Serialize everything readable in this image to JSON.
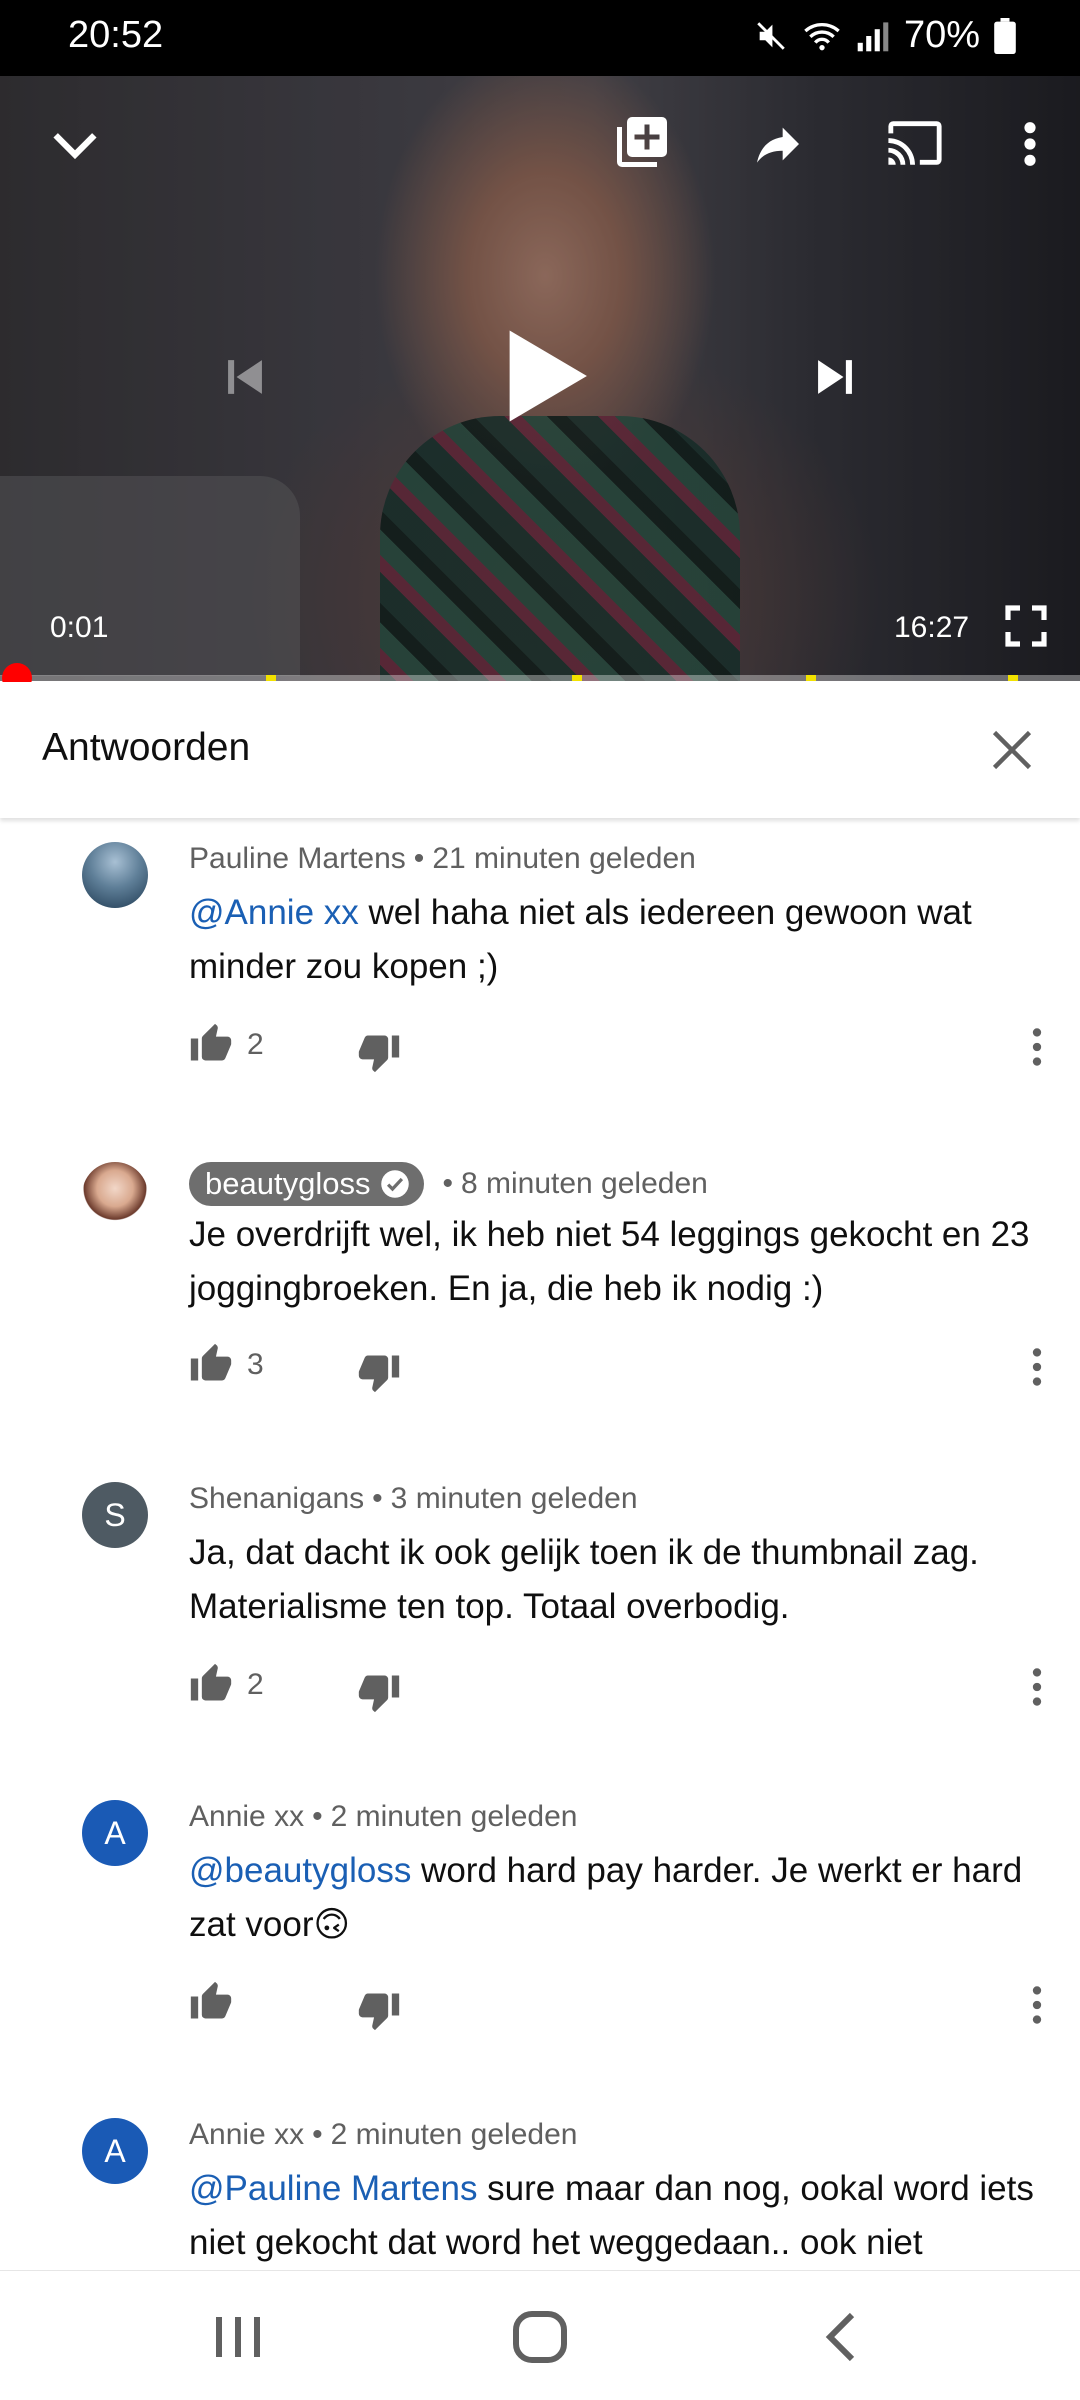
{
  "status_bar": {
    "time": "20:52",
    "battery": "70%"
  },
  "player": {
    "current_time": "0:01",
    "duration": "16:27",
    "progress_fraction": 0.0006
  },
  "replies": {
    "title": "Antwoorden"
  },
  "comments": [
    {
      "author": "Pauline Martens",
      "time": "21 minuten geleden",
      "mention": "@Annie xx",
      "text": " wel haha niet als iedereen gewoon wat minder zou kopen ;)",
      "likes": "2"
    },
    {
      "author": "beautygloss",
      "verified": true,
      "time": "8 minuten geleden",
      "mention": "",
      "text": "Je overdrijft wel, ik heb niet 54 leggings gekocht en 23 joggingbroeken. En ja, die heb ik nodig :)",
      "likes": "3"
    },
    {
      "author": "Shenanigans",
      "avatar_letter": "S",
      "time": "3 minuten geleden",
      "mention": "",
      "text": "Ja, dat dacht ik ook gelijk toen ik de thumbnail zag. Materialisme ten top. Totaal overbodig.",
      "likes": "2"
    },
    {
      "author": "Annie xx",
      "avatar_letter": "A",
      "time": "2 minuten geleden",
      "mention": "@beautygloss",
      "text": " word hard pay harder. Je werkt er hard zat voor🙃",
      "likes": ""
    },
    {
      "author": "Annie xx",
      "avatar_letter": "A",
      "time": "2 minuten geleden",
      "mention": "@Pauline Martens",
      "text": " sure maar dan nog, ookal word iets niet gekocht dat word het weggedaan.. ook niet",
      "likes": ""
    }
  ],
  "colors": {
    "accent_red": "#ff0000",
    "mention_blue": "#1a5fb4",
    "chapter_marker": "#f2e200"
  }
}
